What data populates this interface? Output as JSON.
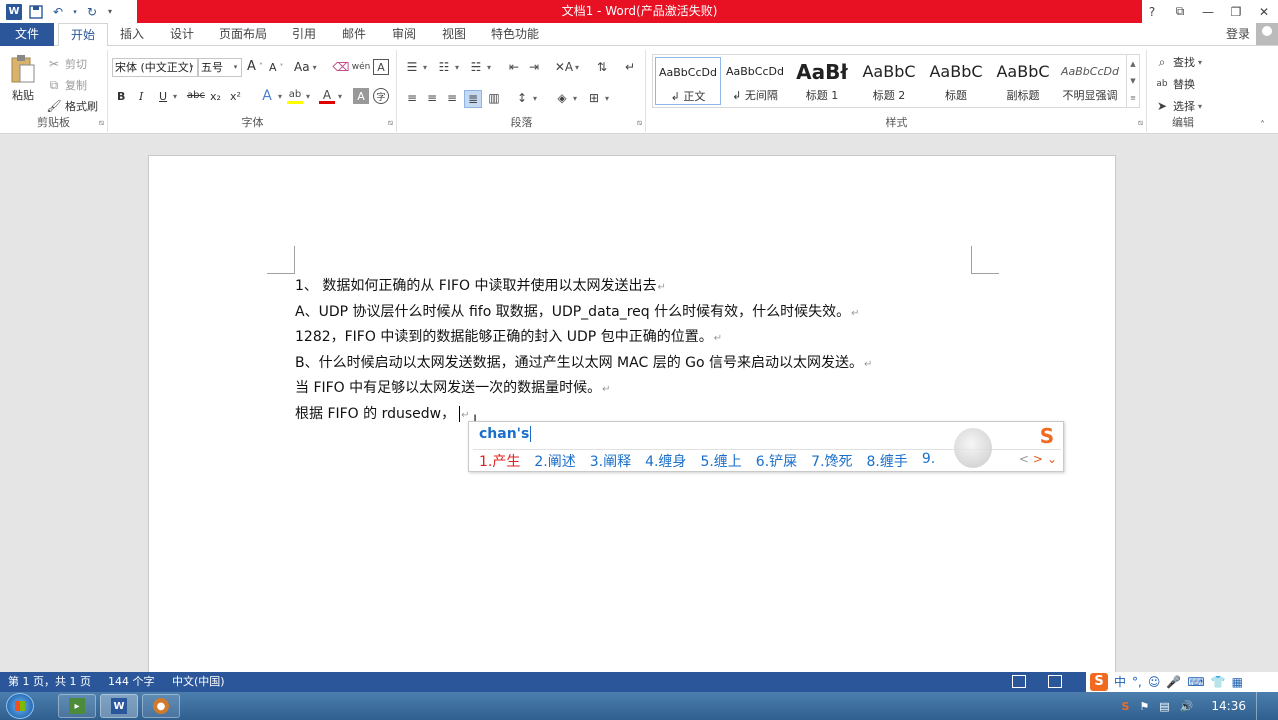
{
  "window": {
    "title": "文档1 -  Word(产品激活失败)",
    "controls": {
      "help": "?",
      "ribbon_options": "⧉",
      "minimize": "—",
      "restore": "❐",
      "close": "✕"
    }
  },
  "qat": {
    "save": "save-icon",
    "undo": "undo-icon",
    "redo": "redo-icon",
    "customize": "▾"
  },
  "tabs": {
    "file": "文件",
    "items": [
      "开始",
      "插入",
      "设计",
      "页面布局",
      "引用",
      "邮件",
      "审阅",
      "视图",
      "特色功能"
    ],
    "active": "开始",
    "login": "登录"
  },
  "clipboard": {
    "paste": "粘贴",
    "cut": "剪切",
    "copy": "复制",
    "format_painter": "格式刷",
    "label": "剪贴板"
  },
  "font": {
    "name": "宋体 (中文正文)",
    "size": "五号",
    "grow": "A",
    "shrink": "A",
    "case": "Aa",
    "bold": "B",
    "italic": "I",
    "underline": "U",
    "strike": "abc",
    "subscript": "x₂",
    "superscript": "x²",
    "label": "字体"
  },
  "paragraph": {
    "label": "段落"
  },
  "styles": {
    "items": [
      {
        "preview": "AaBbCcDd",
        "name": "↲ 正文"
      },
      {
        "preview": "AaBbCcDd",
        "name": "↲ 无间隔"
      },
      {
        "preview": "AaBł",
        "name": "标题 1"
      },
      {
        "preview": "AaBbC",
        "name": "标题 2"
      },
      {
        "preview": "AaBbC",
        "name": "标题"
      },
      {
        "preview": "AaBbC",
        "name": "副标题"
      },
      {
        "preview": "AaBbCcDd",
        "name": "不明显强调"
      }
    ],
    "label": "样式"
  },
  "editing": {
    "find": "查找",
    "replace": "替换",
    "select": "选择",
    "label": "编辑"
  },
  "document": {
    "lines": [
      "1、 数据如何正确的从 FIFO 中读取并使用以太网发送出去",
      "A、UDP 协议层什么时候从 fifo 取数据，UDP_data_req 什么时候有效，什么时候失效。",
      "1282，FIFO 中读到的数据能够正确的封入 UDP 包中正确的位置。",
      "B、什么时候启动以太网发送数据，通过产生以太网 MAC 层的 Go 信号来启动以太网发送。",
      "当 FIFO 中有足够以太网发送一次的数据量时候。",
      "根据 FIFO 的 rdusedw，"
    ],
    "para_mark": "↵"
  },
  "ime": {
    "composition": "chan's",
    "candidates": [
      "1.产生",
      "2.阐述",
      "3.阐释",
      "4.缠身",
      "5.缠上",
      "6.铲屎",
      "7.馋死",
      "8.缠手",
      "9."
    ],
    "nav_prev": "<",
    "nav_next": ">",
    "expand": "⌄"
  },
  "status": {
    "page": "第 1 页，共 1 页",
    "words": "144 个字",
    "language": "中文(中国)"
  },
  "tray": {
    "ime_mode": "中",
    "punct": "°,",
    "time": "14:36"
  },
  "colors": {
    "title_red": "#e81123",
    "word_blue": "#2b579a",
    "ime_blue": "#1a6fc9",
    "ime_red": "#e02020",
    "sogou_orange": "#f06a22"
  }
}
